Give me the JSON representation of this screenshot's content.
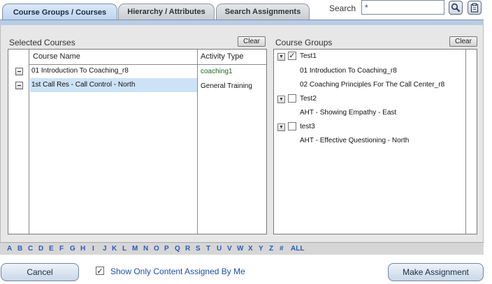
{
  "tabs": [
    {
      "label": "Course Groups / Courses",
      "active": true
    },
    {
      "label": "Hierarchy / Attributes",
      "active": false
    },
    {
      "label": "Search Assignments",
      "active": false
    }
  ],
  "search": {
    "label": "Search",
    "value": "*"
  },
  "icons": {
    "search_button": "magnifier-icon",
    "clipboard_button": "clipboard-icon"
  },
  "selected_courses": {
    "title": "Selected Courses",
    "clear_label": "Clear",
    "columns": [
      "Course Name",
      "Activity Type"
    ],
    "rows": [
      {
        "name": "01 Introduction To Coaching_r8",
        "type": "coaching1",
        "selected": false
      },
      {
        "name": "1st Call Res - Call Control - North",
        "type": "General Training",
        "selected": true
      }
    ]
  },
  "course_groups": {
    "title": "Course Groups",
    "clear_label": "Clear",
    "groups": [
      {
        "name": "Test1",
        "checked": true,
        "courses": [
          "01 Introduction To Coaching_r8",
          "02 Coaching Principles For The Call Center_r8"
        ]
      },
      {
        "name": "Test2",
        "checked": false,
        "courses": [
          "AHT - Showing Empathy - East"
        ]
      },
      {
        "name": "test3",
        "checked": false,
        "courses": [
          "AHT - Effective Questioning - North"
        ]
      }
    ]
  },
  "alphabet": [
    "A",
    "B",
    "C",
    "D",
    "E",
    "F",
    "G",
    "H",
    "I",
    "J",
    "K",
    "L",
    "M",
    "N",
    "O",
    "P",
    "Q",
    "R",
    "S",
    "T",
    "U",
    "V",
    "W",
    "X",
    "Y",
    "Z",
    "#",
    "ALL"
  ],
  "footer": {
    "cancel_label": "Cancel",
    "show_only_label": "Show Only Content Assigned By Me",
    "show_only_checked": true,
    "make_assignment_label": "Make Assignment"
  },
  "colors": {
    "accent": "#b8cce6",
    "link": "#2a5cb8",
    "selected_row": "#cce2f7"
  }
}
